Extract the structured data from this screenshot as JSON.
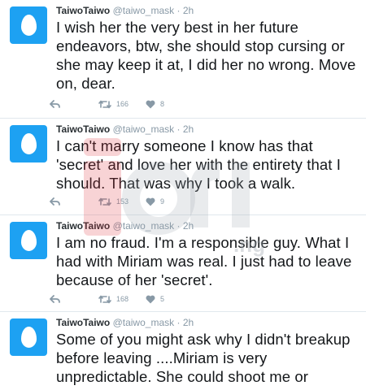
{
  "colors": {
    "avatar": "#1da1f2",
    "secondary_text": "#8899a6",
    "body_text": "#14171a",
    "watermark_red": "#e0383e"
  },
  "watermark": {
    "text": ".ng"
  },
  "tweets": [
    {
      "name": "TaiwoTaiwo",
      "handle": "@taiwo_mask",
      "separator": "·",
      "time": "2h",
      "text": "I wish her the very best in her future endeavors, btw, she should stop cursing or she may keep it at, I did her no wrong. Move on, dear.",
      "retweets": "166",
      "likes": "8",
      "avatar_icon": "egg-avatar-icon"
    },
    {
      "name": "TaiwoTaiwo",
      "handle": "@taiwo_mask",
      "separator": "·",
      "time": "2h",
      "text": "I can't marry someone I know has that 'secret' and love her with the entirety that I should. That was why I took a walk.",
      "retweets": "153",
      "likes": "9",
      "avatar_icon": "egg-avatar-icon"
    },
    {
      "name": "TaiwoTaiwo",
      "handle": "@taiwo_mask",
      "separator": "·",
      "time": "2h",
      "text": "I am no fraud. I'm a responsible guy. What I had with Miriam was real. I just had to leave because of her 'secret'.",
      "retweets": "168",
      "likes": "5",
      "avatar_icon": "egg-avatar-icon"
    },
    {
      "name": "TaiwoTaiwo",
      "handle": "@taiwo_mask",
      "separator": "·",
      "time": "2h",
      "text": "Some of you might ask why I didn't breakup before leaving ....Miriam is very unpredictable. She could shoot me or",
      "avatar_icon": "egg-avatar-icon"
    }
  ]
}
